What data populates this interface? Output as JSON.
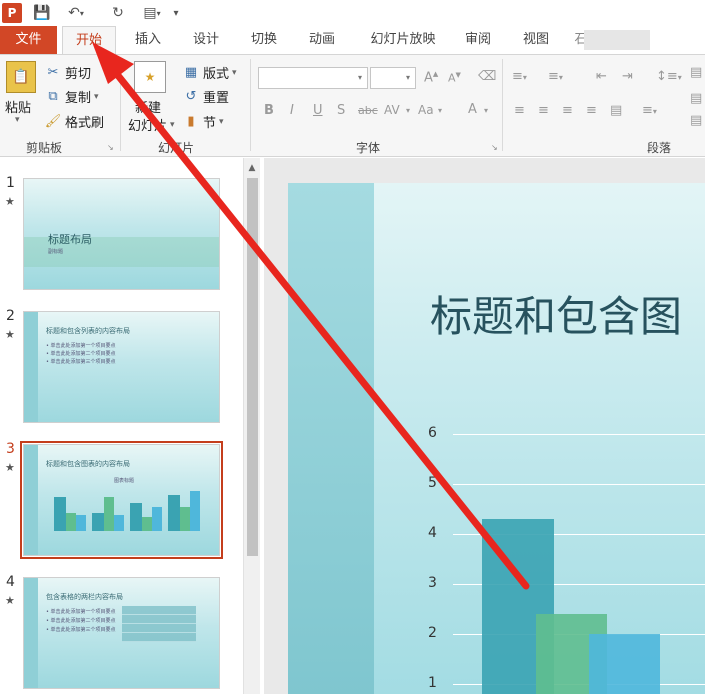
{
  "qat": {
    "app_letter": "P"
  },
  "tabs": {
    "file": "文件",
    "home": "开始",
    "insert": "插入",
    "design": "设计",
    "transitions": "切换",
    "animations": "动画",
    "slideshow": "幻灯片放映",
    "review": "审阅",
    "view": "视图",
    "partial": "石"
  },
  "ribbon": {
    "clipboard": {
      "paste": "粘贴",
      "cut": "剪切",
      "copy": "复制",
      "format_painter": "格式刷",
      "label": "剪贴板"
    },
    "slides": {
      "new_top": "新建",
      "new_bottom": "幻灯片",
      "layout": "版式",
      "reset": "重置",
      "section": "节",
      "label": "幻灯片"
    },
    "font": {
      "label": "字体",
      "bold": "B",
      "italic": "I",
      "underline": "U",
      "shadow": "S",
      "strike": "abc",
      "spacing": "AV",
      "case": "Aa",
      "color": "A"
    },
    "paragraph": {
      "label": "段落"
    }
  },
  "thumbnails": [
    {
      "number": "1",
      "title": "标题布局",
      "subtitle": "副标题"
    },
    {
      "number": "2",
      "title": "标题和包含列表的内容布局",
      "lines": [
        "• 单击此处添加第一个项目要点",
        "• 单击此处添加第二个项目要点",
        "• 单击此处添加第三个项目要点"
      ]
    },
    {
      "number": "3",
      "title": "标题和包含图表的内容布局",
      "chart_title": "图表标题"
    },
    {
      "number": "4",
      "title": "包含表格的两栏内容布局",
      "lines": [
        "• 单击此处添加第一个项目要点",
        "• 单击此处添加第二个项目要点",
        "• 单击此处添加第三个项目要点"
      ]
    }
  ],
  "slide": {
    "title": "标题和包含图"
  },
  "chart_data": {
    "type": "bar",
    "title": "",
    "xlabel": "",
    "ylabel": "",
    "ylim": [
      0,
      6
    ],
    "yticks": [
      "1",
      "2",
      "3",
      "4",
      "5",
      "6"
    ],
    "categories": [
      ""
    ],
    "series": [
      {
        "values": [
          4.3
        ],
        "color": "#3aa3b2"
      },
      {
        "values": [
          2.4
        ],
        "color": "#5fbe8f"
      },
      {
        "values": [
          2.0
        ],
        "color": "#4fb7db"
      }
    ]
  },
  "colors": {
    "accent": "#d24726",
    "arrow": "#e8261e"
  }
}
